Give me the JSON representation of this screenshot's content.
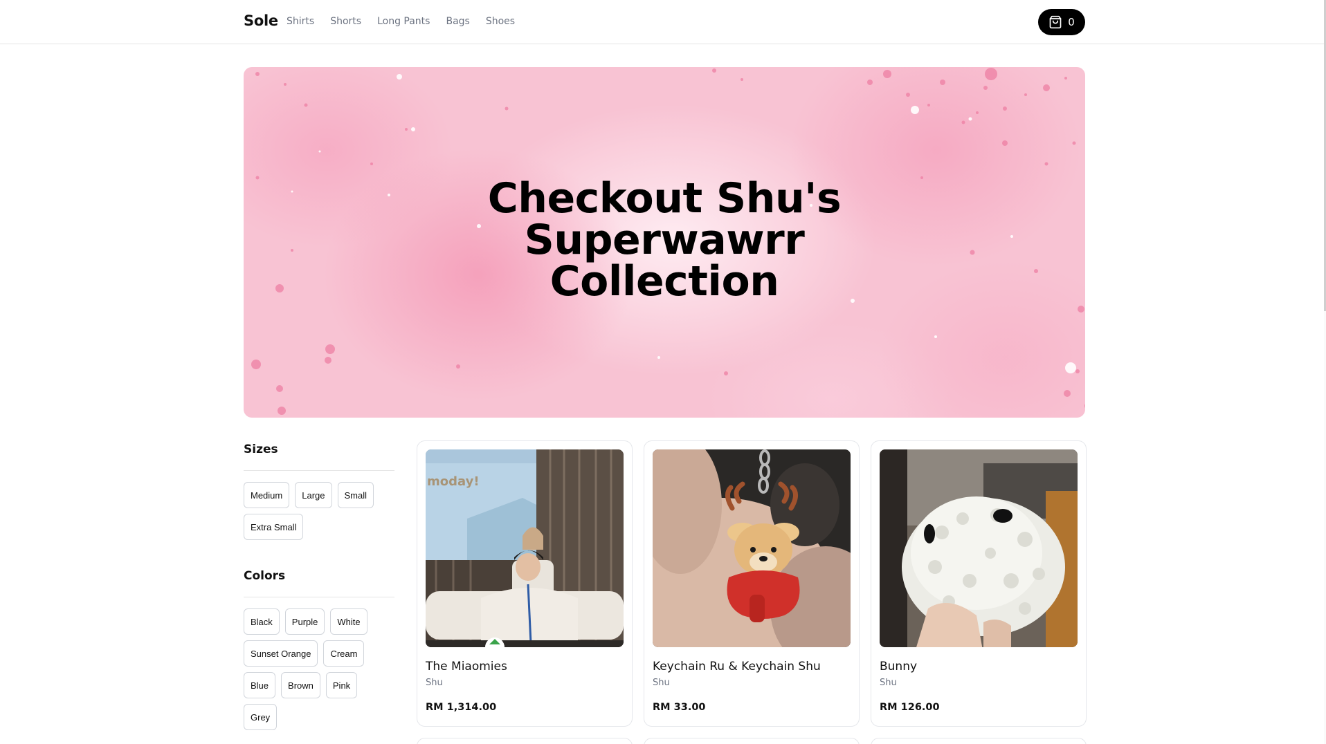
{
  "header": {
    "logo": "Sole",
    "nav": [
      "Shirts",
      "Shorts",
      "Long Pants",
      "Bags",
      "Shoes"
    ],
    "cart_count": "0"
  },
  "billboard": {
    "title_lines": [
      "Checkout Shu's",
      "Superwawrr",
      "Collection"
    ]
  },
  "filters": {
    "sizes": {
      "heading": "Sizes",
      "options": [
        "Medium",
        "Large",
        "Small",
        "Extra Small"
      ]
    },
    "colors": {
      "heading": "Colors",
      "options": [
        "Black",
        "Purple",
        "White",
        "Sunset Orange",
        "Cream",
        "Blue",
        "Brown",
        "Pink",
        "Grey"
      ]
    }
  },
  "products": [
    {
      "name": "The Miaomies",
      "brand": "Shu",
      "price": "RM 1,314.00",
      "image": "photo-two-people-at-event"
    },
    {
      "name": "Keychain Ru & Keychain Shu",
      "brand": "Shu",
      "price": "RM 33.00",
      "image": "photo-deer-keychain"
    },
    {
      "name": "Bunny",
      "brand": "Shu",
      "price": "RM 126.00",
      "image": "photo-fluffy-plush"
    }
  ],
  "colors": {
    "accent": "#000000",
    "muted_text": "#6b7280",
    "border": "#e5e7eb",
    "billboard_pink": "#f8c3d3"
  },
  "icons": {
    "cart": "shopping-bag-icon"
  }
}
